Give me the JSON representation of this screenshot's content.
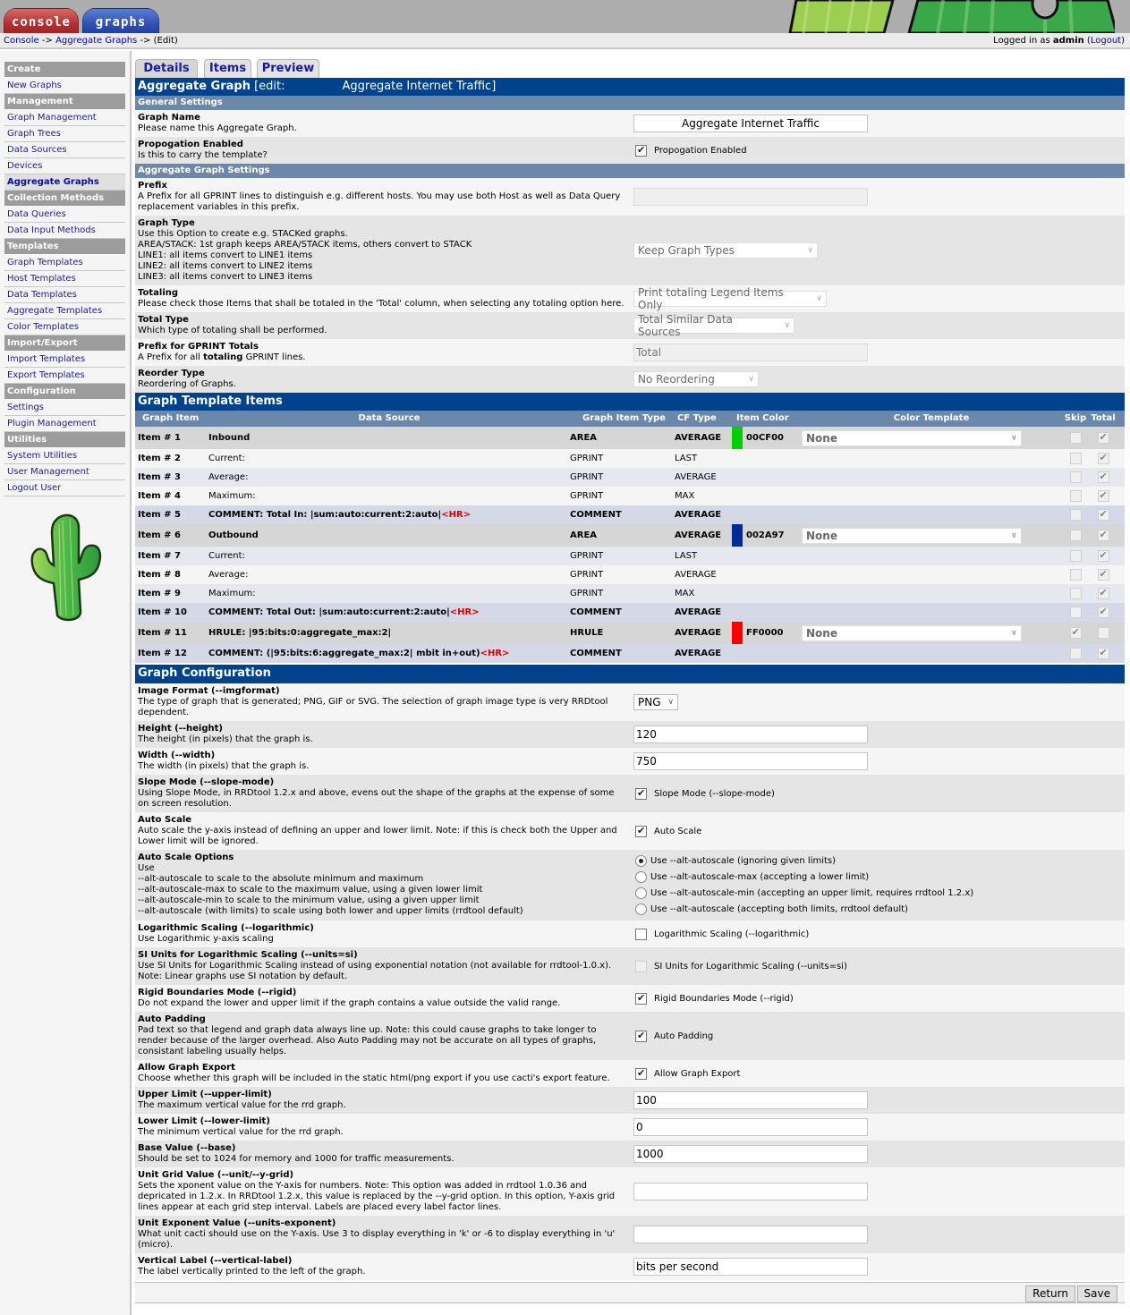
{
  "top_tabs": {
    "console": "console",
    "graphs": "graphs"
  },
  "breadcrumb": {
    "console": "Console",
    "sep1": " -> ",
    "aggregate_graphs": "Aggregate Graphs",
    "sep2": " -> ",
    "current": "(Edit)"
  },
  "login": {
    "prefix": "Logged in as ",
    "user": "admin",
    "open": " (",
    "logout": "Logout",
    "close": ")"
  },
  "sidebar": {
    "groups": [
      {
        "header": "Create",
        "items": [
          "New Graphs"
        ]
      },
      {
        "header": "Management",
        "items": [
          "Graph Management",
          "Graph Trees",
          "Data Sources",
          "Devices",
          "Aggregate Graphs"
        ]
      },
      {
        "header": "Collection Methods",
        "items": [
          "Data Queries",
          "Data Input Methods"
        ]
      },
      {
        "header": "Templates",
        "items": [
          "Graph Templates",
          "Host Templates",
          "Data Templates",
          "Aggregate Templates",
          "Color Templates"
        ]
      },
      {
        "header": "Import/Export",
        "items": [
          "Import Templates",
          "Export Templates"
        ]
      },
      {
        "header": "Configuration",
        "items": [
          "Settings",
          "Plugin Management"
        ]
      },
      {
        "header": "Utilities",
        "items": [
          "System Utilities",
          "User Management",
          "Logout User"
        ]
      }
    ],
    "active_item": "Aggregate Graphs"
  },
  "tabs": [
    "Details",
    "Items",
    "Preview"
  ],
  "header": {
    "title_bold": "Aggregate Graph",
    "title_rest": " [edit:",
    "graph_name": "Aggregate Internet Traffic]"
  },
  "general": {
    "title": "General Settings",
    "graph_name": {
      "label": "Graph Name",
      "desc": "Please name this Aggregate Graph.",
      "value": "Aggregate Internet Traffic"
    },
    "propogation": {
      "label": "Propogation Enabled",
      "desc": "Is this to carry the template?",
      "checkbox_label": "Propogation Enabled",
      "checked": true
    }
  },
  "aggregate": {
    "title": "Aggregate Graph Settings",
    "prefix": {
      "label": "Prefix",
      "desc": "A Prefix for all GPRINT lines to distinguish e.g. different hosts. You may use both Host as well as Data Query replacement variables in this prefix.",
      "value": ""
    },
    "graph_type": {
      "label": "Graph Type",
      "desc": "Use this Option to create e.g. STACKed graphs.\nAREA/STACK: 1st graph keeps AREA/STACK items, others convert to STACK\nLINE1: all items convert to LINE1 items\nLINE2: all items convert to LINE2 items\nLINE3: all items convert to LINE3 items",
      "value": "Keep Graph Types"
    },
    "totaling": {
      "label": "Totaling",
      "desc": "Please check those Items that shall be totaled in the 'Total' column, when selecting any totaling option here.",
      "value": "Print totaling Legend Items Only"
    },
    "total_type": {
      "label": "Total Type",
      "desc": "Which type of totaling shall be performed.",
      "value": "Total Similar Data Sources"
    },
    "prefix_totals": {
      "label": "Prefix for GPRINT Totals",
      "desc_pre": "A Prefix for all ",
      "desc_bold": "totaling",
      "desc_post": " GPRINT lines.",
      "value": "Total"
    },
    "reorder": {
      "label": "Reorder Type",
      "desc": "Reordering of Graphs.",
      "value": "No Reordering"
    }
  },
  "items": {
    "title": "Graph Template Items",
    "columns": [
      "Graph Item",
      "Data Source",
      "Graph Item Type",
      "CF Type",
      "Item Color",
      "Color Template",
      "Skip",
      "Total"
    ],
    "rows": [
      {
        "item": "Item # 1",
        "source": "Inbound",
        "hr": "",
        "type": "AREA",
        "cf": "AVERAGE",
        "color": "00CF00",
        "template": "None",
        "skip": false,
        "total": true,
        "kind": "main"
      },
      {
        "item": "Item # 2",
        "source": "Current:",
        "hr": "",
        "type": "GPRINT",
        "cf": "LAST",
        "color": "",
        "template": "",
        "skip": false,
        "total": true,
        "kind": "g-odd"
      },
      {
        "item": "Item # 3",
        "source": "Average:",
        "hr": "",
        "type": "GPRINT",
        "cf": "AVERAGE",
        "color": "",
        "template": "",
        "skip": false,
        "total": true,
        "kind": "g-even"
      },
      {
        "item": "Item # 4",
        "source": "Maximum:",
        "hr": "",
        "type": "GPRINT",
        "cf": "MAX",
        "color": "",
        "template": "",
        "skip": false,
        "total": true,
        "kind": "g-odd"
      },
      {
        "item": "Item # 5",
        "source": "COMMENT: Total In: |sum:auto:current:2:auto|",
        "hr": "<HR>",
        "type": "COMMENT",
        "cf": "AVERAGE",
        "color": "",
        "template": "",
        "skip": false,
        "total": true,
        "kind": "comment"
      },
      {
        "item": "Item # 6",
        "source": "Outbound",
        "hr": "",
        "type": "AREA",
        "cf": "AVERAGE",
        "color": "002A97",
        "template": "None",
        "skip": false,
        "total": true,
        "kind": "main"
      },
      {
        "item": "Item # 7",
        "source": "Current:",
        "hr": "",
        "type": "GPRINT",
        "cf": "LAST",
        "color": "",
        "template": "",
        "skip": false,
        "total": true,
        "kind": "g-even"
      },
      {
        "item": "Item # 8",
        "source": "Average:",
        "hr": "",
        "type": "GPRINT",
        "cf": "AVERAGE",
        "color": "",
        "template": "",
        "skip": false,
        "total": true,
        "kind": "g-odd"
      },
      {
        "item": "Item # 9",
        "source": "Maximum:",
        "hr": "",
        "type": "GPRINT",
        "cf": "MAX",
        "color": "",
        "template": "",
        "skip": false,
        "total": true,
        "kind": "g-even"
      },
      {
        "item": "Item # 10",
        "source": "COMMENT: Total Out: |sum:auto:current:2:auto|",
        "hr": "<HR>",
        "type": "COMMENT",
        "cf": "AVERAGE",
        "color": "",
        "template": "",
        "skip": false,
        "total": true,
        "kind": "comment"
      },
      {
        "item": "Item # 11",
        "source": "HRULE: |95:bits:0:aggregate_max:2|",
        "hr": "",
        "type": "HRULE",
        "cf": "AVERAGE",
        "color": "FF0000",
        "template": "None",
        "skip": true,
        "total": false,
        "kind": "main"
      },
      {
        "item": "Item # 12",
        "source": "COMMENT: (|95:bits:6:aggregate_max:2| mbit in+out)",
        "hr": "<HR>",
        "type": "COMMENT",
        "cf": "AVERAGE",
        "color": "",
        "template": "",
        "skip": false,
        "total": true,
        "kind": "comment"
      }
    ]
  },
  "config": {
    "title": "Graph Configuration",
    "image_format": {
      "label": "Image Format (--imgformat)",
      "desc": "The type of graph that is generated; PNG, GIF or SVG. The selection of graph image type is very RRDtool dependent.",
      "value": "PNG"
    },
    "height": {
      "label": "Height (--height)",
      "desc": "The height (in pixels) that the graph is.",
      "value": "120"
    },
    "width": {
      "label": "Width (--width)",
      "desc": "The width (in pixels) that the graph is.",
      "value": "750"
    },
    "slope_mode": {
      "label": "Slope Mode (--slope-mode)",
      "desc": "Using Slope Mode, in RRDtool 1.2.x and above, evens out the shape of the graphs at the expense of some on screen resolution.",
      "checkbox_label": "Slope Mode (--slope-mode)",
      "checked": true
    },
    "auto_scale": {
      "label": "Auto Scale",
      "desc": "Auto scale the y-axis instead of defining an upper and lower limit. Note: if this is check both the Upper and Lower limit will be ignored.",
      "checkbox_label": "Auto Scale",
      "checked": true
    },
    "auto_scale_options": {
      "label": "Auto Scale Options",
      "desc": "Use\n--alt-autoscale to scale to the absolute minimum and maximum\n--alt-autoscale-max to scale to the maximum value, using a given lower limit\n--alt-autoscale-min to scale to the minimum value, using a given upper limit\n--alt-autoscale (with limits) to scale using both lower and upper limits (rrdtool default)",
      "options": [
        "Use --alt-autoscale (ignoring given limits)",
        "Use --alt-autoscale-max (accepting a lower limit)",
        "Use --alt-autoscale-min (accepting an upper limit, requires rrdtool 1.2.x)",
        "Use --alt-autoscale (accepting both limits, rrdtool default)"
      ],
      "selected": 0
    },
    "logarithmic": {
      "label": "Logarithmic Scaling (--logarithmic)",
      "desc": "Use Logarithmic y-axis scaling",
      "checkbox_label": "Logarithmic Scaling (--logarithmic)",
      "checked": false
    },
    "si_units": {
      "label": "SI Units for Logarithmic Scaling (--units=si)",
      "desc": "Use SI Units for Logarithmic Scaling instead of using exponential notation (not available for rrdtool-1.0.x).\nNote: Linear graphs use SI notation by default.",
      "checkbox_label": "SI Units for Logarithmic Scaling (--units=si)",
      "checked": false
    },
    "rigid": {
      "label": "Rigid Boundaries Mode (--rigid)",
      "desc": "Do not expand the lower and upper limit if the graph contains a value outside the valid range.",
      "checkbox_label": "Rigid Boundaries Mode (--rigid)",
      "checked": true
    },
    "auto_padding": {
      "label": "Auto Padding",
      "desc": "Pad text so that legend and graph data always line up. Note: this could cause graphs to take longer to render because of the larger overhead. Also Auto Padding may not be accurate on all types of graphs, consistant labeling usually helps.",
      "checkbox_label": "Auto Padding",
      "checked": true
    },
    "export": {
      "label": "Allow Graph Export",
      "desc": "Choose whether this graph will be included in the static html/png export if you use cacti's export feature.",
      "checkbox_label": "Allow Graph Export",
      "checked": true
    },
    "upper_limit": {
      "label": "Upper Limit (--upper-limit)",
      "desc": "The maximum vertical value for the rrd graph.",
      "value": "100"
    },
    "lower_limit": {
      "label": "Lower Limit (--lower-limit)",
      "desc": "The minimum vertical value for the rrd graph.",
      "value": "0"
    },
    "base_value": {
      "label": "Base Value (--base)",
      "desc": "Should be set to 1024 for memory and 1000 for traffic measurements.",
      "value": "1000"
    },
    "unit_grid": {
      "label": "Unit Grid Value (--unit/--y-grid)",
      "desc": "Sets the xponent value on the Y-axis for numbers. Note: This option was added in rrdtool 1.0.36 and depricated in 1.2.x. In RRDtool 1.2.x, this value is replaced by the --y-grid option. In this option, Y-axis grid lines appear at each grid step interval. Labels are placed every label factor lines.",
      "value": ""
    },
    "unit_exponent": {
      "label": "Unit Exponent Value (--units-exponent)",
      "desc": "What unit cacti should use on the Y-axis. Use 3 to display everything in 'k' or -6 to display everything in 'u' (micro).",
      "value": ""
    },
    "vertical_label": {
      "label": "Vertical Label (--vertical-label)",
      "desc": "The label vertically printed to the left of the graph.",
      "value": "bits per second"
    }
  },
  "buttons": {
    "return": "Return",
    "save": "Save"
  }
}
